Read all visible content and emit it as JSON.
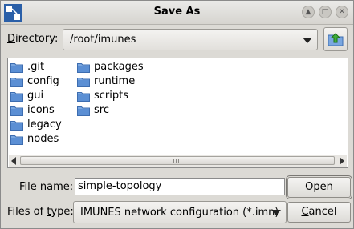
{
  "window": {
    "title": "Save As",
    "controls": [
      {
        "name": "minimize-icon",
        "glyph": "▲"
      },
      {
        "name": "maximize-icon",
        "glyph": "□"
      },
      {
        "name": "close-icon",
        "glyph": "✕"
      }
    ]
  },
  "directory": {
    "label_prefix": "D",
    "label_rest": "irectory:",
    "value": "/root/imunes",
    "up_icon": "folder-up-icon"
  },
  "files": {
    "column1": [
      ".git",
      "config",
      "gui",
      "icons",
      "legacy",
      "nodes"
    ],
    "column2": [
      "packages",
      "runtime",
      "scripts",
      "src"
    ]
  },
  "filename": {
    "label_prefix": "File ",
    "label_u": "n",
    "label_rest": "ame:",
    "value": "simple-topology"
  },
  "filetype": {
    "label_prefix": "Files of ",
    "label_u": "t",
    "label_rest": "ype:",
    "value": "IMUNES network configuration (*.imn)"
  },
  "buttons": {
    "open_u": "O",
    "open_rest": "pen",
    "cancel_u": "C",
    "cancel_rest": "ancel"
  },
  "colors": {
    "folder": "#5b8fd4",
    "background": "#dcdad5"
  }
}
